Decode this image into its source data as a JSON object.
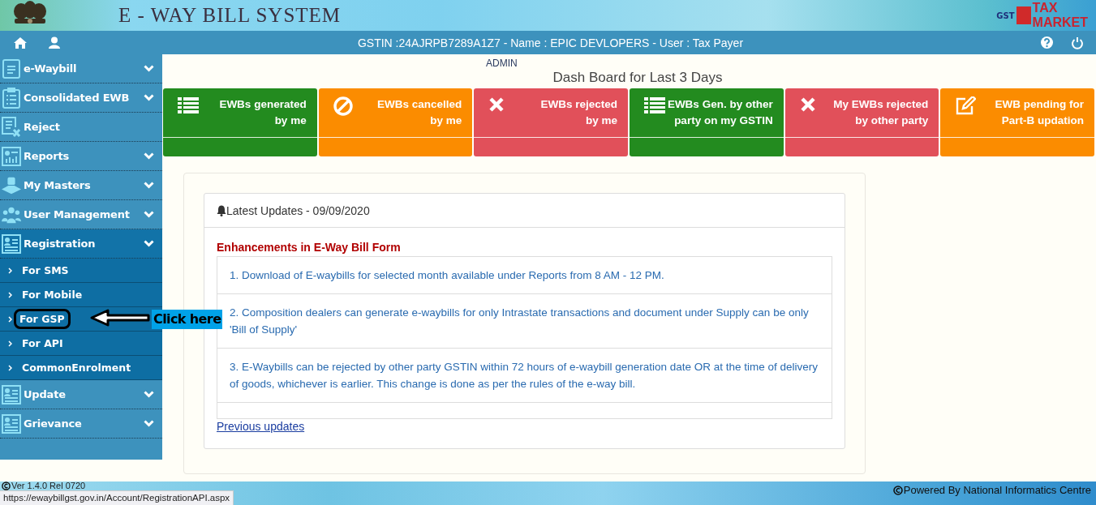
{
  "header": {
    "title": "E - WAY BILL SYSTEM",
    "partner_logo": {
      "badge": "GST",
      "line_1": "TAX",
      "line_2": "MARKET"
    }
  },
  "top_bar": {
    "user_info": "GSTIN :24AJRPB7289A1Z7 - Name : EPIC DEVLOPERS - User : Tax Payer"
  },
  "sidebar": {
    "items": [
      {
        "kind": "menu",
        "label": "e-Waybill",
        "selected": false
      },
      {
        "kind": "menu",
        "label": "Consolidated EWB",
        "selected": false
      },
      {
        "kind": "link",
        "label": "Reject",
        "selected": false
      },
      {
        "kind": "menu",
        "label": "Reports",
        "selected": false
      },
      {
        "kind": "menu",
        "label": "My Masters",
        "selected": false
      },
      {
        "kind": "menu",
        "label": "User Management",
        "selected": false
      },
      {
        "kind": "menu",
        "label": "Registration",
        "selected": true,
        "children": [
          {
            "label": "For SMS"
          },
          {
            "label": "For Mobile"
          },
          {
            "label": "For GSP",
            "callout": "Click here"
          },
          {
            "label": "For API"
          },
          {
            "label": "CommonEnrolment"
          }
        ]
      },
      {
        "kind": "menu",
        "label": "Update",
        "selected": false
      },
      {
        "kind": "menu",
        "label": "Grievance",
        "selected": false
      }
    ]
  },
  "main": {
    "role": "ADMIN",
    "heading": "Dash Board for Last 3 Days",
    "cards": [
      {
        "color": "#238b1f",
        "lines": [
          "EWBs generated",
          "by me"
        ]
      },
      {
        "color": "#fb8c00",
        "lines": [
          "EWBs cancelled",
          "by me"
        ]
      },
      {
        "color": "#e1505a",
        "lines": [
          "EWBs rejected",
          "by me"
        ]
      },
      {
        "color": "#238b1f",
        "lines": [
          "EWBs Gen. by other",
          "party on my GSTIN"
        ]
      },
      {
        "color": "#e1505a",
        "lines": [
          "My EWBs rejected",
          "by other party"
        ]
      },
      {
        "color": "#fb8c00",
        "lines": [
          "EWB pending for",
          "Part-B updation"
        ]
      }
    ],
    "updates": {
      "title": "Latest Updates - 09/09/2020",
      "subtitle": "Enhancements in E-Way Bill Form",
      "items": [
        "1. Download of E-waybills for selected month available under Reports from 8 AM - 12 PM.",
        "2. Composition dealers can generate e-waybills for only Intrastate transactions and document under Supply can be only 'Bill of Supply'",
        "3. E-Waybills can be rejected by other party GSTIN within 72 hours of e-waybill generation date OR at the time of delivery of goods, whichever is earlier. This change is done as per the rules of the e-way bill."
      ],
      "more_link": "Previous updates"
    }
  },
  "footer": {
    "version": "Ver 1.4.0 Rel 0720",
    "credit": "Powered By National Informatics Centre"
  },
  "status_url": "https://ewaybillgst.gov.in/Account/RegistrationAPI.aspx"
}
